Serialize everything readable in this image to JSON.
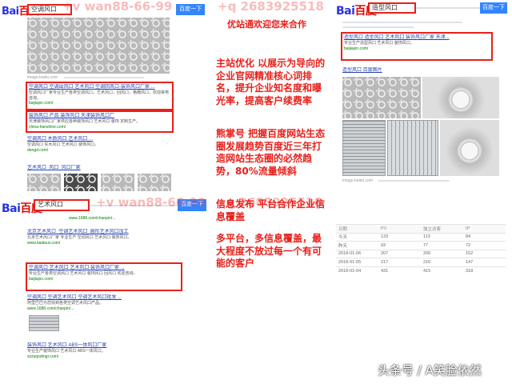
{
  "watermarks": {
    "left": "+v wan88-66-99",
    "right": "+q 2683925518"
  },
  "top_left": {
    "logo_text": "百度",
    "query": "空调风口",
    "button": "百度一下",
    "image_caption": "image.baidu.com",
    "results": [
      {
        "title": "空调风口 空调出风口 艺术风口 空调回风口-装饰风口厂家 ...",
        "desc": "空调风口厂家专业生产各类空调风口，艺术风口，回风口，格栅风口，欢迎来电咨询。",
        "url": "baijiajxn.com/"
      },
      {
        "title": "装饰风口 产品 装饰风口 天津装饰风口厂",
        "desc": "天津装饰风口厂家供应各种装饰风口 艺术风口 装饰 定制生产。",
        "url": "china-haoshine.com/"
      },
      {
        "title": "空调风口 木质风口 艺术风口 ...",
        "desc": "空调风口 实木风口 艺术风口 装饰风口。",
        "url": "dengd.com/"
      }
    ],
    "related": "艺术风口_风口_风口厂家"
  },
  "bottom_left": {
    "logo_text": "百度",
    "query": "艺术风口",
    "button": "百度一下",
    "url_line": "www.1688.com/chanpin/...",
    "results": [
      {
        "title": "北京艺术风口_空调艺术风口_圆形艺术风口加工",
        "desc": "北京艺术风口厂家 专业生产 空调风口 艺术风口 装饰风口。",
        "url": "www.baiduuv.com/"
      },
      {
        "title": "空调风口 艺术风口 艺术风口 装饰风口厂家 ...",
        "desc": "专业生产各类空调风口 艺术风口 装饰风口 回风口 欢迎咨询。",
        "url": "baijiajxn.com/"
      },
      {
        "title": "空调风口 空调艺术风口 空调艺术风口批发 ...",
        "desc": "阿里巴巴为您找到各类空调艺术风口产品。",
        "url": "www.1688.com/chanpin/..."
      },
      {
        "title": "装饰风口 艺术风口 ABS一体风口厂家",
        "desc": "专业生产装饰风口 艺术风口 ABS一体风口。",
        "url": "szzuqodmgr.com/"
      }
    ]
  },
  "promo": {
    "headline": "优站通欢迎您来合作",
    "paragraphs": [
      "主站优化 以展示为导向的企业官网精准核心词排名，提升企业知名度和曝光率，提高客户续费率",
      "熊掌号 把握百度网站生态圈发展趋势百度近三年打造网站生态圈的必然趋势，80%流量倾斜",
      "信息发布 平台合作企业信息覆盖",
      "多平台，多信息覆盖，最大程度不放过每一个有可能的客户"
    ]
  },
  "top_right": {
    "logo_text": "百度",
    "query": "造型风口",
    "button": "百度一下",
    "results": [
      {
        "title": "造型风口 造型风口 艺术风口 装饰风口厂家 天津...",
        "desc": "专业生产造型风口 艺术风口 装饰风口。",
        "url": "baijiajxn.com/"
      },
      {
        "title": "造型风口 百度图片",
        "desc": "",
        "url": "image.baidu.com"
      }
    ]
  },
  "stats_table": {
    "headers": [
      "日期",
      "PV",
      "独立访客",
      "IP"
    ],
    "rows": [
      [
        "今天",
        "133",
        "113",
        "84"
      ],
      [
        "昨天",
        "93",
        "77",
        "72"
      ],
      [
        "2018-01-06",
        "207",
        "206",
        "152"
      ],
      [
        "2018-01-05",
        "217",
        "216",
        "147"
      ],
      [
        "2018-01-04",
        "431",
        "415",
        "318"
      ]
    ]
  },
  "footer": "头条号 / A笑脸依然"
}
